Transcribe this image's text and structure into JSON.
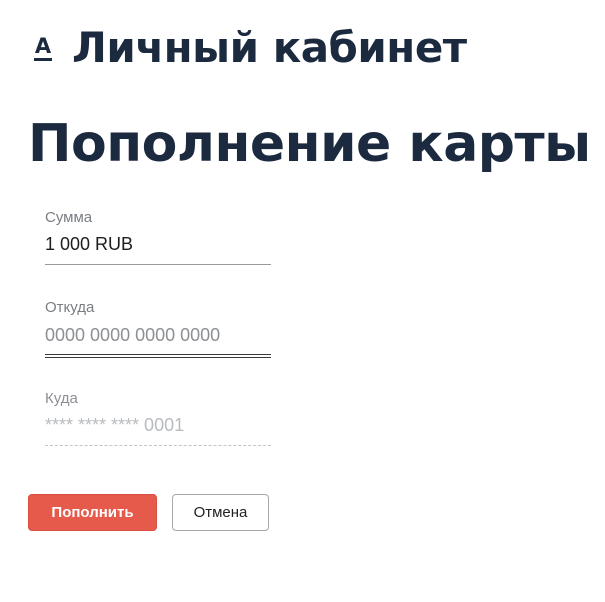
{
  "header": {
    "logo_letter": "А",
    "app_title": "Личный кабинет"
  },
  "page_title": "Пополнение карты",
  "form": {
    "amount": {
      "label": "Сумма",
      "value": "1 000 RUB"
    },
    "from": {
      "label": "Откуда",
      "placeholder": "0000 0000 0000 0000"
    },
    "to": {
      "label": "Куда",
      "value": "**** **** **** 0001"
    }
  },
  "actions": {
    "submit_label": "Пополнить",
    "cancel_label": "Отмена"
  },
  "colors": {
    "primary": "#e65a4b",
    "heading": "#1c2a3f"
  }
}
